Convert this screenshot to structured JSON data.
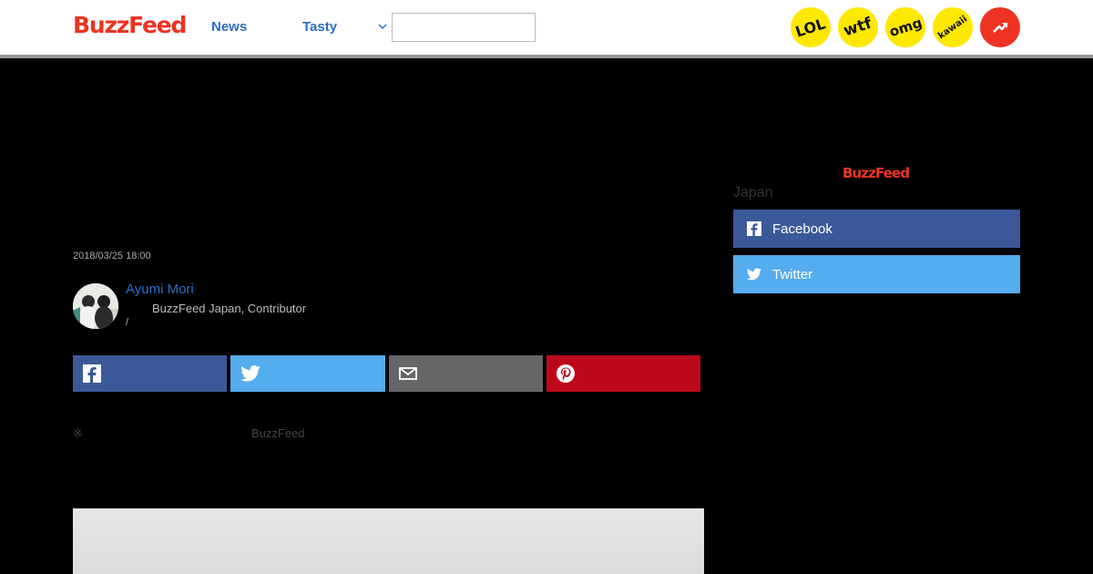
{
  "header": {
    "logo": "BuzzFeed",
    "nav": [
      {
        "label": "News"
      },
      {
        "label": "Tasty"
      }
    ],
    "search": {
      "value": "",
      "placeholder": ""
    },
    "badges": [
      {
        "label": "LOL"
      },
      {
        "label": "wtf"
      },
      {
        "label": "omg"
      },
      {
        "label": "kawaii"
      }
    ],
    "trending_icon": "trending-arrow-icon"
  },
  "article": {
    "date": "2018/03/25 18:00",
    "author": {
      "name": "Ayumi Mori",
      "role": "BuzzFeed Japan, Contributor",
      "separator": "/"
    },
    "share_buttons": [
      {
        "icon": "facebook-icon",
        "color": "#3b5998"
      },
      {
        "icon": "twitter-icon",
        "color": "#55acee"
      },
      {
        "icon": "mail-icon",
        "color": "#666666"
      },
      {
        "icon": "pinterest-icon",
        "color": "#bd081c"
      }
    ],
    "note_mark": "※",
    "note_text": "BuzzFeed"
  },
  "sidebar": {
    "logo": "BuzzFeed",
    "region": "Japan",
    "follow_buttons": [
      {
        "label": "Facebook",
        "icon": "facebook-icon",
        "color": "#3b5998"
      },
      {
        "label": "Twitter",
        "icon": "twitter-icon",
        "color": "#55acee"
      }
    ]
  },
  "colors": {
    "brand_red": "#ee3322",
    "link_blue": "#2c6ec4",
    "badge_yellow": "#ffe800"
  }
}
